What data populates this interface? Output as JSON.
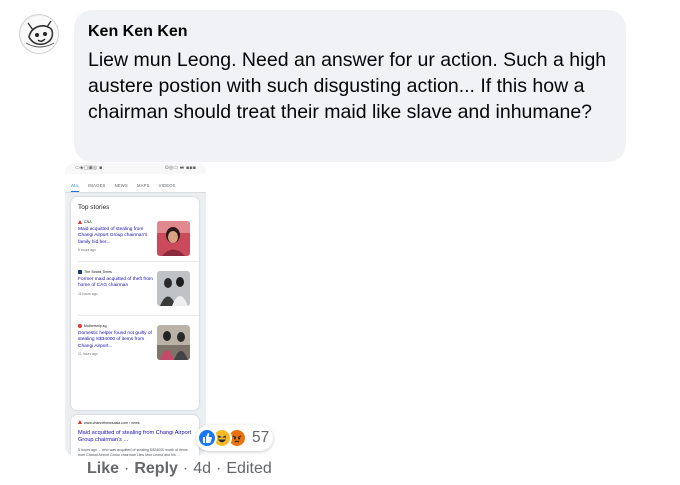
{
  "comment": {
    "author": "Ken Ken Ken",
    "text": "Liew mun Leong. Need an answer for ur action. Such a high austere postion with such disgusting action... If this how a chairman should treat their maid like slave and inhumane?"
  },
  "attachment": {
    "status_left": "▭◈▢▣◎ ▪",
    "status_right": "⊙◎▭ ▬ ▪▪▪",
    "tabs": [
      "ALL",
      "IMAGES",
      "NEWS",
      "MAPS",
      "VIDEOS"
    ],
    "active_tab": "ALL",
    "section_title": "Top stories",
    "stories": [
      {
        "source": "CNA",
        "title": "Maid acquitted of stealing from Changi Airport Group chairman's family hid her...",
        "age": "5 hours ago",
        "source_color": "#d93025"
      },
      {
        "source": "The Straits Times",
        "title": "Former maid acquitted of theft from home of CAG chairman",
        "age": "11 hours ago",
        "source_color": "#1a3c6e"
      },
      {
        "source": "Mothership.sg",
        "title": "Domestic helper found not guilty of stealing S$34000 of items from Changi Airport...",
        "age": "21 hours ago",
        "source_color": "#e53935"
      }
    ],
    "web_result": {
      "source": "www.channelnewsasia.com › news",
      "title": "Maid acquitted of stealing from Changi Airport Group chairman's ...",
      "snippet": "5 hours ago ... who was acquitted of stealing S$34000 worth of items from Changi Airport Group chairman Liew Mun Leong and his ..."
    }
  },
  "reactions": {
    "icons": [
      "like-icon",
      "haha-icon",
      "angry-icon"
    ],
    "count": "57",
    "colors": {
      "like": "#1877f2",
      "haha": "#f7b928",
      "angry": "#e9710f"
    }
  },
  "actions": {
    "like": "Like",
    "separator": "·",
    "reply": "Reply",
    "age": "4d",
    "edited": "Edited"
  }
}
